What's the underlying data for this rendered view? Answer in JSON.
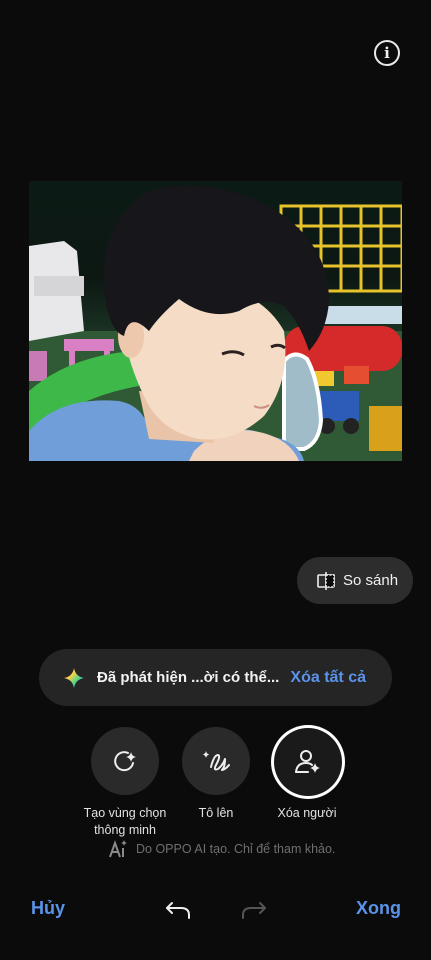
{
  "header": {
    "info_icon": "info-icon"
  },
  "compare": {
    "label": "So sánh",
    "icon": "compare-split-icon"
  },
  "banner": {
    "message": "Đã phát hiện ...ời có thể...",
    "action": "Xóa tất cả",
    "icon": "ai-sparkle-icon"
  },
  "tools": [
    {
      "label": "Tạo vùng chọn\nthông minh",
      "icon": "smart-select-icon",
      "active": false
    },
    {
      "label": "Tô lên",
      "icon": "brush-icon",
      "active": false
    },
    {
      "label": "Xóa người",
      "icon": "erase-person-icon",
      "active": true
    }
  ],
  "disclaimer": {
    "text": "Do OPPO AI tạo. Chỉ để tham khảo.",
    "icon": "ai-badge-icon"
  },
  "bottom": {
    "cancel": "Hủy",
    "done": "Xong",
    "undo_icon": "undo-icon",
    "redo_icon": "redo-icon"
  },
  "colors": {
    "accent": "#5b93ea",
    "background": "#0b0b0b",
    "panel": "#252525"
  }
}
